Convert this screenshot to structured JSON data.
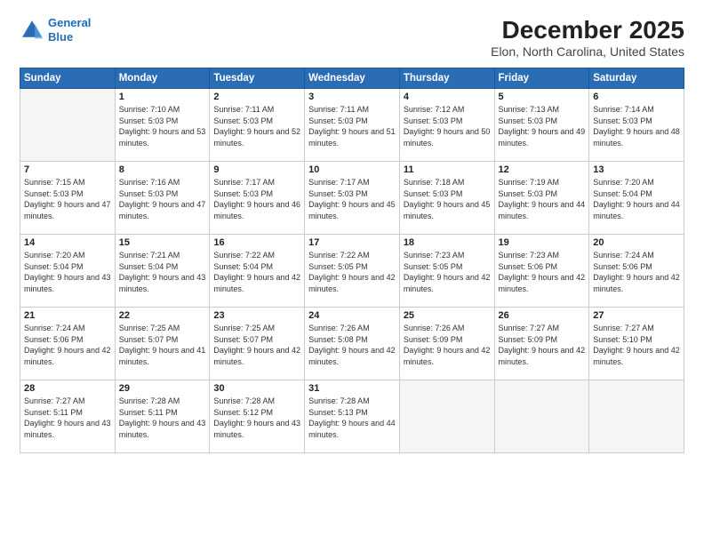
{
  "header": {
    "logo_line1": "General",
    "logo_line2": "Blue",
    "title": "December 2025",
    "subtitle": "Elon, North Carolina, United States"
  },
  "days_of_week": [
    "Sunday",
    "Monday",
    "Tuesday",
    "Wednesday",
    "Thursday",
    "Friday",
    "Saturday"
  ],
  "weeks": [
    [
      {
        "day": "",
        "sunrise": "",
        "sunset": "",
        "daylight": "",
        "empty": true
      },
      {
        "day": "1",
        "sunrise": "Sunrise: 7:10 AM",
        "sunset": "Sunset: 5:03 PM",
        "daylight": "Daylight: 9 hours and 53 minutes."
      },
      {
        "day": "2",
        "sunrise": "Sunrise: 7:11 AM",
        "sunset": "Sunset: 5:03 PM",
        "daylight": "Daylight: 9 hours and 52 minutes."
      },
      {
        "day": "3",
        "sunrise": "Sunrise: 7:11 AM",
        "sunset": "Sunset: 5:03 PM",
        "daylight": "Daylight: 9 hours and 51 minutes."
      },
      {
        "day": "4",
        "sunrise": "Sunrise: 7:12 AM",
        "sunset": "Sunset: 5:03 PM",
        "daylight": "Daylight: 9 hours and 50 minutes."
      },
      {
        "day": "5",
        "sunrise": "Sunrise: 7:13 AM",
        "sunset": "Sunset: 5:03 PM",
        "daylight": "Daylight: 9 hours and 49 minutes."
      },
      {
        "day": "6",
        "sunrise": "Sunrise: 7:14 AM",
        "sunset": "Sunset: 5:03 PM",
        "daylight": "Daylight: 9 hours and 48 minutes."
      }
    ],
    [
      {
        "day": "7",
        "sunrise": "Sunrise: 7:15 AM",
        "sunset": "Sunset: 5:03 PM",
        "daylight": "Daylight: 9 hours and 47 minutes."
      },
      {
        "day": "8",
        "sunrise": "Sunrise: 7:16 AM",
        "sunset": "Sunset: 5:03 PM",
        "daylight": "Daylight: 9 hours and 47 minutes."
      },
      {
        "day": "9",
        "sunrise": "Sunrise: 7:17 AM",
        "sunset": "Sunset: 5:03 PM",
        "daylight": "Daylight: 9 hours and 46 minutes."
      },
      {
        "day": "10",
        "sunrise": "Sunrise: 7:17 AM",
        "sunset": "Sunset: 5:03 PM",
        "daylight": "Daylight: 9 hours and 45 minutes."
      },
      {
        "day": "11",
        "sunrise": "Sunrise: 7:18 AM",
        "sunset": "Sunset: 5:03 PM",
        "daylight": "Daylight: 9 hours and 45 minutes."
      },
      {
        "day": "12",
        "sunrise": "Sunrise: 7:19 AM",
        "sunset": "Sunset: 5:03 PM",
        "daylight": "Daylight: 9 hours and 44 minutes."
      },
      {
        "day": "13",
        "sunrise": "Sunrise: 7:20 AM",
        "sunset": "Sunset: 5:04 PM",
        "daylight": "Daylight: 9 hours and 44 minutes."
      }
    ],
    [
      {
        "day": "14",
        "sunrise": "Sunrise: 7:20 AM",
        "sunset": "Sunset: 5:04 PM",
        "daylight": "Daylight: 9 hours and 43 minutes."
      },
      {
        "day": "15",
        "sunrise": "Sunrise: 7:21 AM",
        "sunset": "Sunset: 5:04 PM",
        "daylight": "Daylight: 9 hours and 43 minutes."
      },
      {
        "day": "16",
        "sunrise": "Sunrise: 7:22 AM",
        "sunset": "Sunset: 5:04 PM",
        "daylight": "Daylight: 9 hours and 42 minutes."
      },
      {
        "day": "17",
        "sunrise": "Sunrise: 7:22 AM",
        "sunset": "Sunset: 5:05 PM",
        "daylight": "Daylight: 9 hours and 42 minutes."
      },
      {
        "day": "18",
        "sunrise": "Sunrise: 7:23 AM",
        "sunset": "Sunset: 5:05 PM",
        "daylight": "Daylight: 9 hours and 42 minutes."
      },
      {
        "day": "19",
        "sunrise": "Sunrise: 7:23 AM",
        "sunset": "Sunset: 5:06 PM",
        "daylight": "Daylight: 9 hours and 42 minutes."
      },
      {
        "day": "20",
        "sunrise": "Sunrise: 7:24 AM",
        "sunset": "Sunset: 5:06 PM",
        "daylight": "Daylight: 9 hours and 42 minutes."
      }
    ],
    [
      {
        "day": "21",
        "sunrise": "Sunrise: 7:24 AM",
        "sunset": "Sunset: 5:06 PM",
        "daylight": "Daylight: 9 hours and 42 minutes."
      },
      {
        "day": "22",
        "sunrise": "Sunrise: 7:25 AM",
        "sunset": "Sunset: 5:07 PM",
        "daylight": "Daylight: 9 hours and 41 minutes."
      },
      {
        "day": "23",
        "sunrise": "Sunrise: 7:25 AM",
        "sunset": "Sunset: 5:07 PM",
        "daylight": "Daylight: 9 hours and 42 minutes."
      },
      {
        "day": "24",
        "sunrise": "Sunrise: 7:26 AM",
        "sunset": "Sunset: 5:08 PM",
        "daylight": "Daylight: 9 hours and 42 minutes."
      },
      {
        "day": "25",
        "sunrise": "Sunrise: 7:26 AM",
        "sunset": "Sunset: 5:09 PM",
        "daylight": "Daylight: 9 hours and 42 minutes."
      },
      {
        "day": "26",
        "sunrise": "Sunrise: 7:27 AM",
        "sunset": "Sunset: 5:09 PM",
        "daylight": "Daylight: 9 hours and 42 minutes."
      },
      {
        "day": "27",
        "sunrise": "Sunrise: 7:27 AM",
        "sunset": "Sunset: 5:10 PM",
        "daylight": "Daylight: 9 hours and 42 minutes."
      }
    ],
    [
      {
        "day": "28",
        "sunrise": "Sunrise: 7:27 AM",
        "sunset": "Sunset: 5:11 PM",
        "daylight": "Daylight: 9 hours and 43 minutes."
      },
      {
        "day": "29",
        "sunrise": "Sunrise: 7:28 AM",
        "sunset": "Sunset: 5:11 PM",
        "daylight": "Daylight: 9 hours and 43 minutes."
      },
      {
        "day": "30",
        "sunrise": "Sunrise: 7:28 AM",
        "sunset": "Sunset: 5:12 PM",
        "daylight": "Daylight: 9 hours and 43 minutes."
      },
      {
        "day": "31",
        "sunrise": "Sunrise: 7:28 AM",
        "sunset": "Sunset: 5:13 PM",
        "daylight": "Daylight: 9 hours and 44 minutes."
      },
      {
        "day": "",
        "sunrise": "",
        "sunset": "",
        "daylight": "",
        "empty": true
      },
      {
        "day": "",
        "sunrise": "",
        "sunset": "",
        "daylight": "",
        "empty": true
      },
      {
        "day": "",
        "sunrise": "",
        "sunset": "",
        "daylight": "",
        "empty": true
      }
    ]
  ]
}
